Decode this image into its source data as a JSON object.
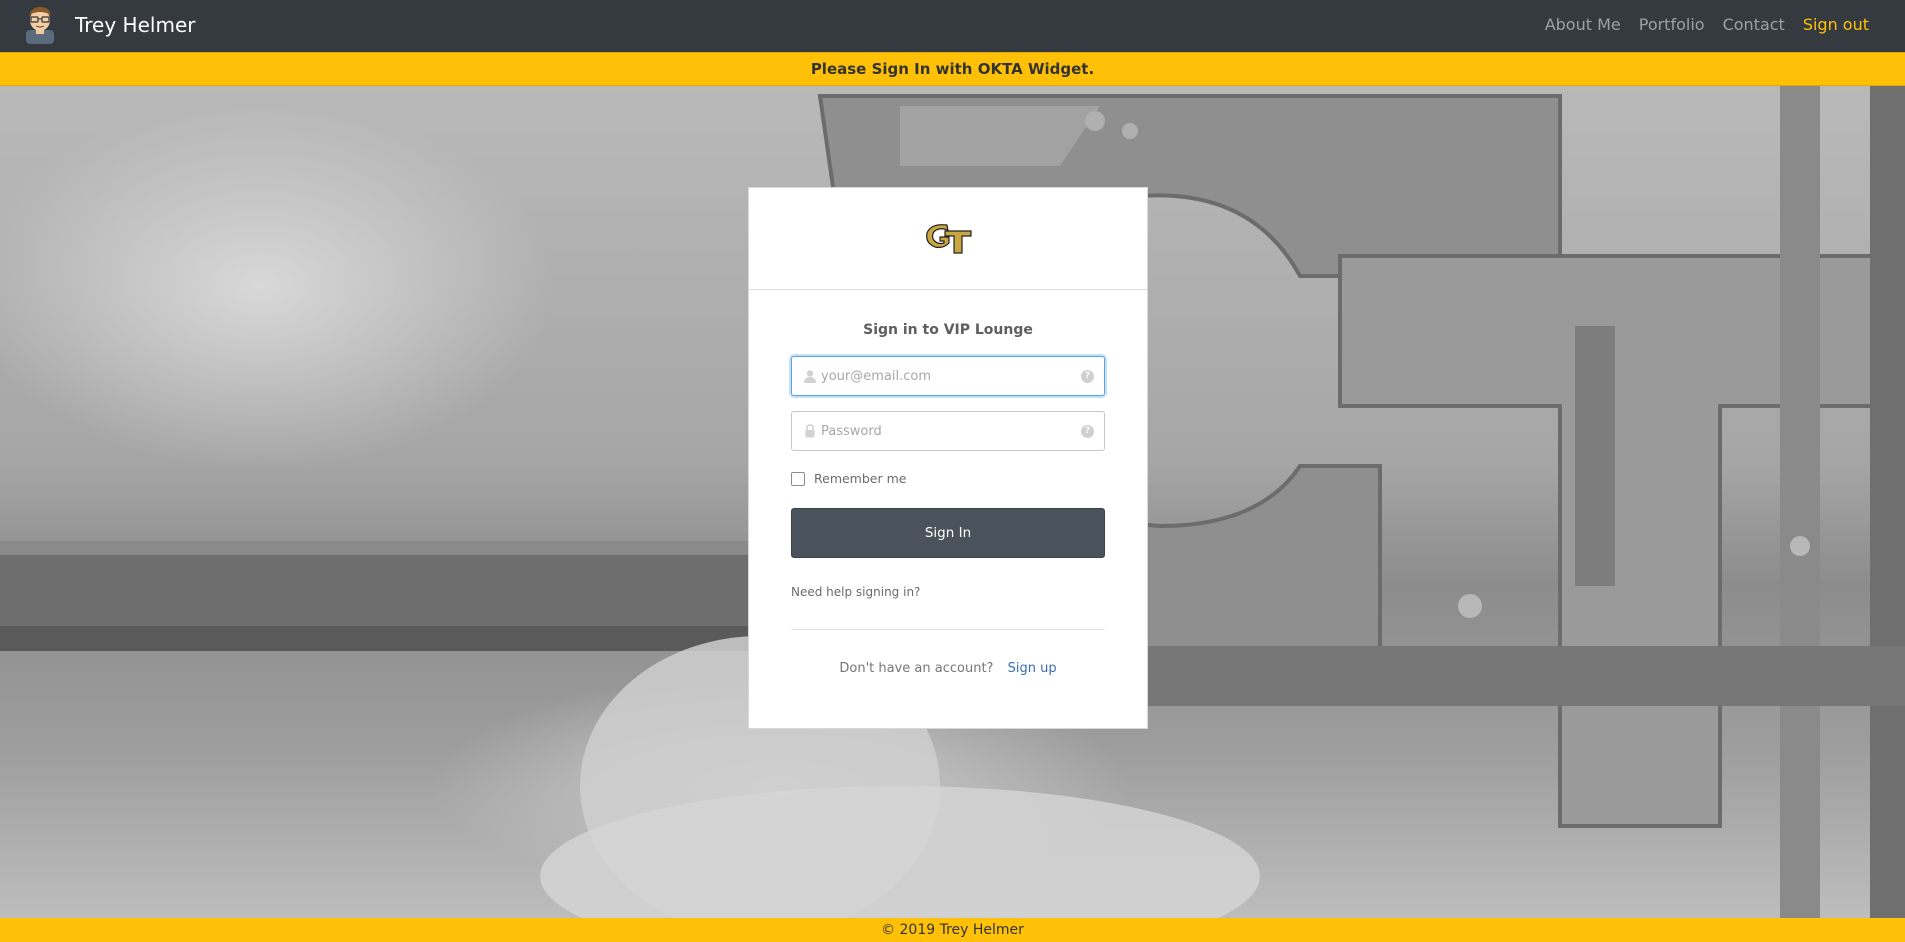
{
  "navbar": {
    "brand": "Trey Helmer",
    "links": [
      {
        "label": "About Me"
      },
      {
        "label": "Portfolio"
      },
      {
        "label": "Contact"
      },
      {
        "label": "Sign out"
      }
    ],
    "accent_color": "#ffc107"
  },
  "banner": {
    "text": "Please Sign In with OKTA Widget."
  },
  "login": {
    "logo_icon": "gt-logo-icon",
    "title": "Sign in to VIP Lounge",
    "username_placeholder": "your@email.com",
    "password_placeholder": "Password",
    "remember_label": "Remember me",
    "signin_label": "Sign In",
    "help_label": "Need help signing in?",
    "no_account_text": "Don't have an account?",
    "signup_label": "Sign up",
    "button_color": "#4a525c"
  },
  "footer": {
    "text": "© 2019 Trey Helmer"
  }
}
